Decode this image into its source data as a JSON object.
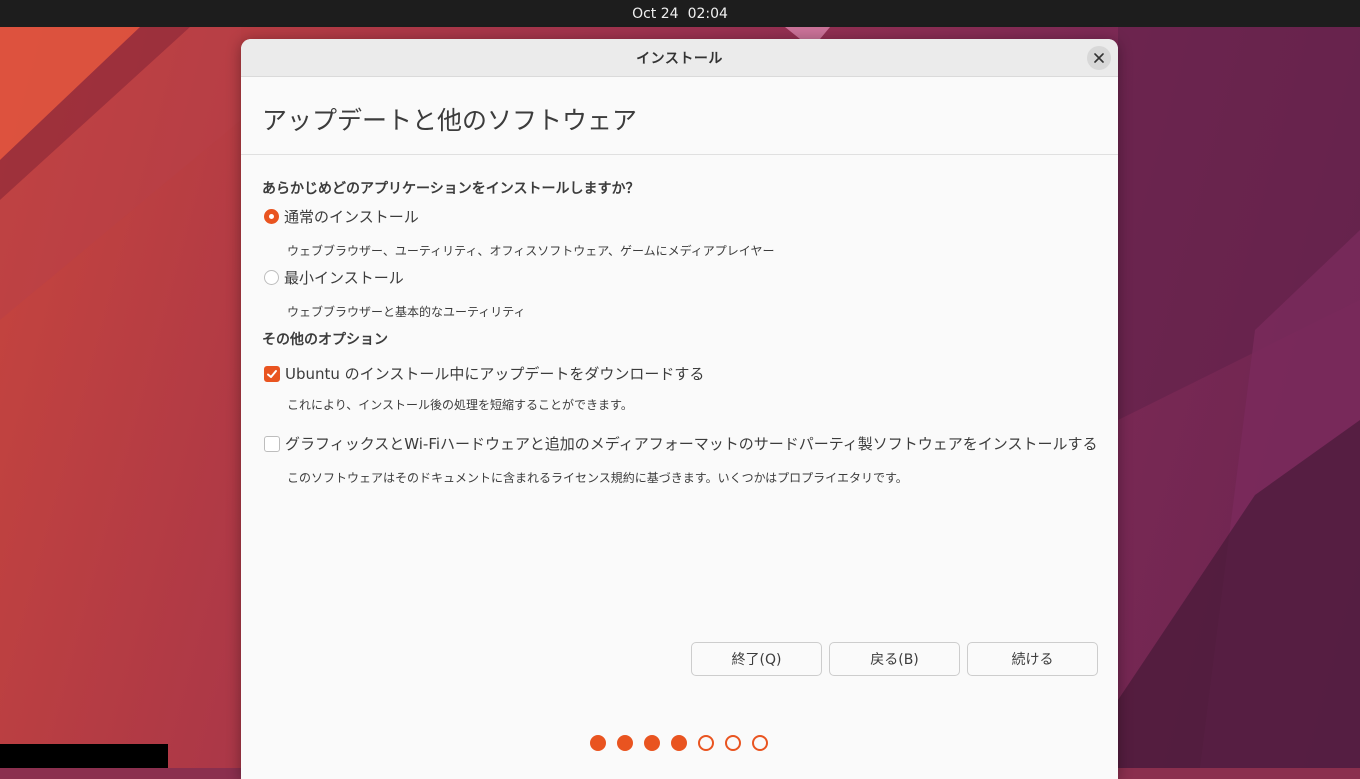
{
  "topbar": {
    "date": "Oct 24",
    "time": "02:04"
  },
  "window": {
    "title": "インストール",
    "close_icon": "close-icon"
  },
  "page": {
    "title": "アップデートと他のソフトウェア"
  },
  "install_type": {
    "question": "あらかじめどのアプリケーションをインストールしますか？",
    "options": [
      {
        "label": "通常のインストール",
        "description": "ウェブブラウザー、ユーティリティ、オフィスソフトウェア、ゲームにメディアプレイヤー",
        "selected": true
      },
      {
        "label": "最小インストール",
        "description": "ウェブブラウザーと基本的なユーティリティ",
        "selected": false
      }
    ]
  },
  "other_options": {
    "heading": "その他のオプション",
    "items": [
      {
        "label": "Ubuntu のインストール中にアップデートをダウンロードする",
        "description": "これにより、インストール後の処理を短縮することができます。",
        "checked": true
      },
      {
        "label": "グラフィックスとWi-Fiハードウェアと追加のメディアフォーマットのサードパーティ製ソフトウェアをインストールする",
        "description": "このソフトウェアはそのドキュメントに含まれるライセンス規約に基づきます。いくつかはプロプライエタリです。",
        "checked": false
      }
    ]
  },
  "buttons": {
    "quit": "終了(Q)",
    "back": "戻る(B)",
    "continue": "続ける"
  },
  "progress": {
    "current_step": 4,
    "total_steps": 7
  },
  "colors": {
    "accent": "#E95420",
    "window_bg": "#FAFAFA",
    "topbar_bg": "#1D1D1D"
  }
}
